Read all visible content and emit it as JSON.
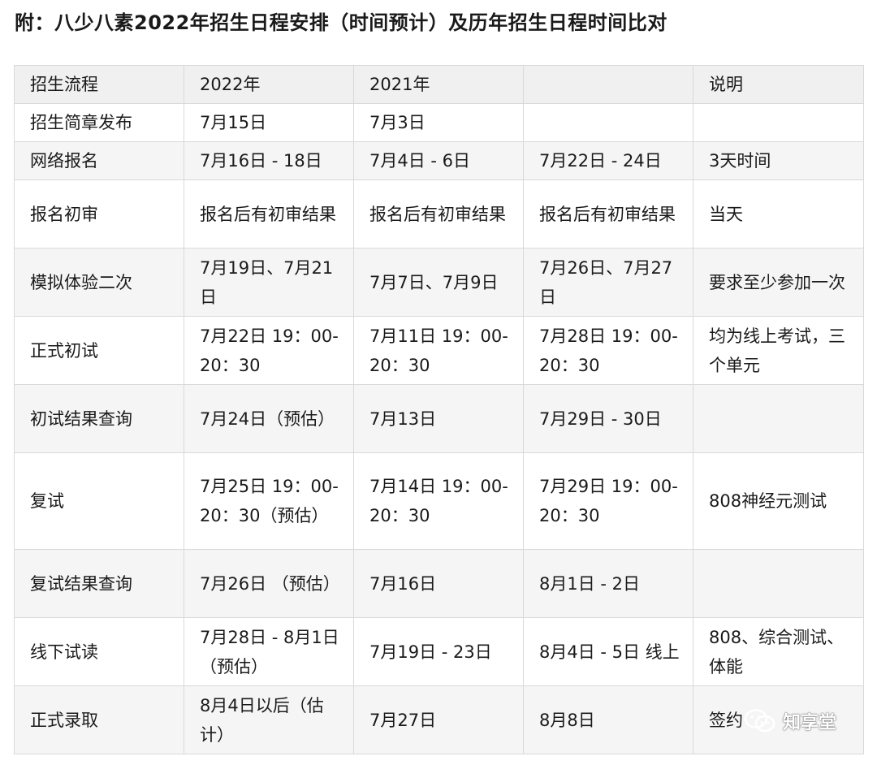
{
  "title": "附：八少八素2022年招生日程安排（时间预计）及历年招生日程时间比对",
  "table": {
    "headers": [
      "招生流程",
      "2022年",
      "2021年",
      "",
      "说明"
    ],
    "rows": [
      [
        "招生简章发布",
        "7月15日",
        "7月3日",
        "",
        ""
      ],
      [
        "网络报名",
        "7月16日 - 18日",
        "7月4日 - 6日",
        "7月22日 - 24日",
        "3天时间"
      ],
      [
        "报名初审",
        "报名后有初审结果",
        "报名后有初审结果",
        "报名后有初审结果",
        "当天"
      ],
      [
        "模拟体验二次",
        "7月19日、7月21日",
        "7月7日、7月9日",
        "7月26日、7月27日",
        "要求至少参加一次"
      ],
      [
        "正式初试",
        "7月22日 19：00-20：30",
        "7月11日 19：00-20：30",
        "7月28日 19：00-20：30",
        "均为线上考试，三个单元"
      ],
      [
        "初试结果查询",
        "7月24日（预估）",
        "7月13日",
        "7月29日 - 30日",
        ""
      ],
      [
        "复试",
        "7月25日 19：00-20：30（预估）",
        "7月14日 19：00-20：30",
        "7月29日 19：00-20：30",
        "808神经元测试"
      ],
      [
        "复试结果查询",
        "7月26日 （预估）",
        "7月16日",
        "8月1日 - 2日",
        ""
      ],
      [
        "线下试读",
        "7月28日 - 8月1日（预估）",
        "7月19日 - 23日",
        "8月4日 - 5日 线上",
        "808、综合测试、体能"
      ],
      [
        "正式录取",
        "8月4日以后（估计）",
        "7月27日",
        "8月8日",
        "签约"
      ]
    ]
  },
  "watermark": {
    "text": "知享堂",
    "icon": "wechat-icon"
  }
}
